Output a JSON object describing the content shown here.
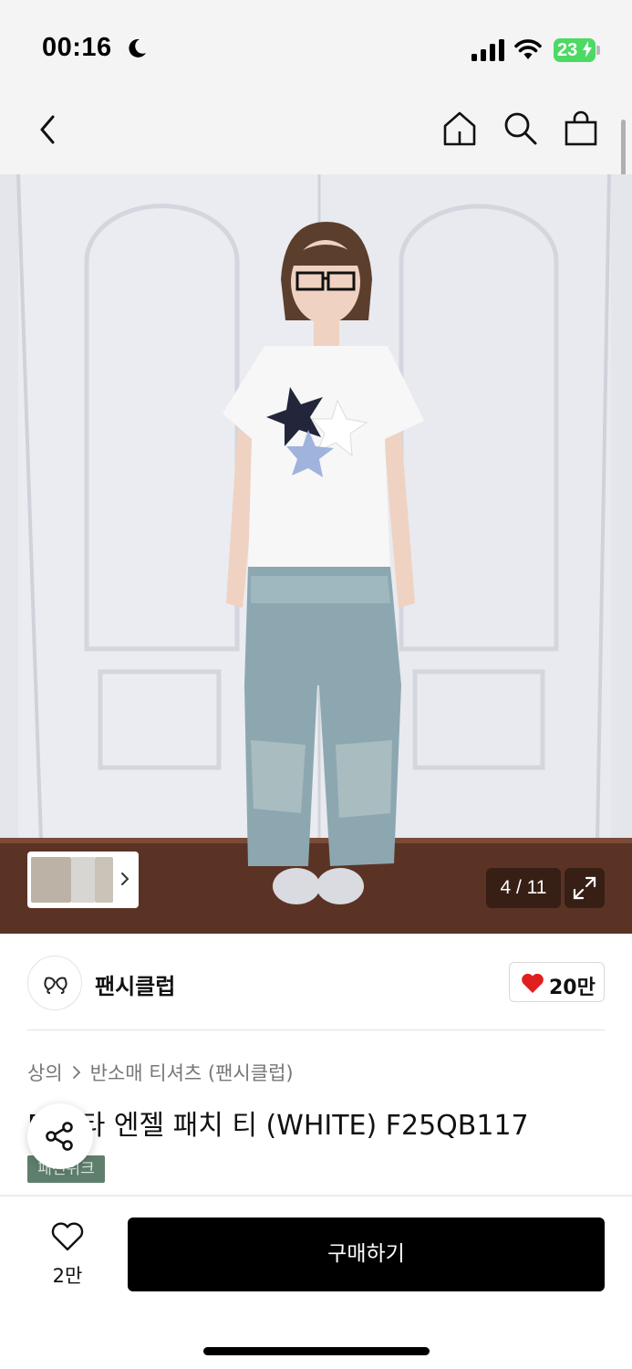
{
  "status_bar": {
    "time": "00:16",
    "battery": "23"
  },
  "nav": {
    "icons": [
      "back-icon",
      "home-icon",
      "search-icon",
      "shopping-bag-icon"
    ]
  },
  "gallery": {
    "counter": "4 / 11",
    "expand_icon": "expand-icon"
  },
  "brand": {
    "name": "팬시클럽",
    "likes": "20만",
    "like_color": "#e0201e"
  },
  "breadcrumb": {
    "category": "상의",
    "subcategory": "반소매 티셔츠 (팬시클럽)"
  },
  "product": {
    "title": "B 스타 엔젤 패치 티 (WHITE) F25QB117",
    "tag": "패션위크",
    "tag_color": "#5e7f6c"
  },
  "bottom_bar": {
    "wish_count": "2만",
    "buy_label": "구매하기"
  }
}
